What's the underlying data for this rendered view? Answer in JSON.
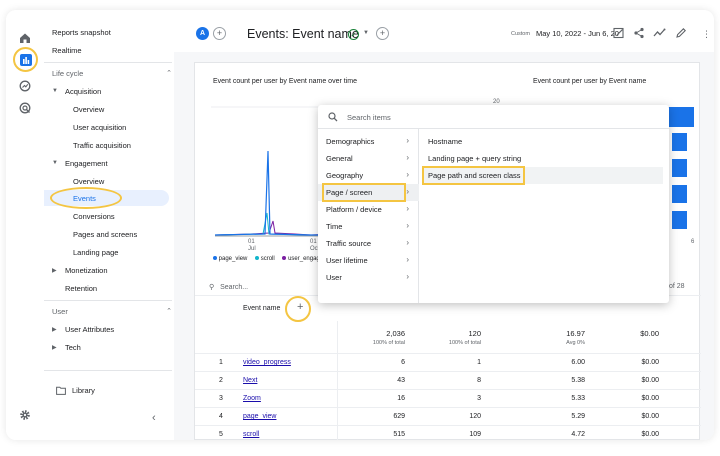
{
  "sidebar": {
    "reports_snapshot": "Reports snapshot",
    "realtime": "Realtime",
    "life_cycle": "Life cycle",
    "acquisition": "Acquisition",
    "acq_overview": "Overview",
    "user_acquisition": "User acquisition",
    "traffic_acquisition": "Traffic acquisition",
    "engagement": "Engagement",
    "eng_overview": "Overview",
    "events": "Events",
    "conversions": "Conversions",
    "pages_and_screens": "Pages and screens",
    "landing_page": "Landing page",
    "monetization": "Monetization",
    "retention": "Retention",
    "user": "User",
    "user_attributes": "User Attributes",
    "tech": "Tech",
    "library": "Library"
  },
  "topbar": {
    "avatar_letter": "A",
    "title": "Events: Event name",
    "date_label": "Custom",
    "date_range": "May 10, 2022 - Jun 6, 20"
  },
  "card": {
    "line_chart_title": "Event count per user by Event name over time",
    "bar_chart_title": "Event count per user by Event name",
    "y_tick_top": "20",
    "x_tick_1_day": "01",
    "x_tick_1_month": "Jul",
    "x_tick_2_day": "01",
    "x_tick_2_month": "Oct",
    "bar_axis_right": "6",
    "legend": [
      "page_view",
      "scroll",
      "user_engag"
    ],
    "search_placeholder": "Search...",
    "pagination": "of 28",
    "event_name_header": "Event name"
  },
  "menu": {
    "search_placeholder": "Search items",
    "categories": [
      "Demographics",
      "General",
      "Geography",
      "Page / screen",
      "Platform / device",
      "Time",
      "Traffic source",
      "User lifetime",
      "User"
    ],
    "options": [
      "Hostname",
      "Landing page + query string",
      "Page path and screen class"
    ]
  },
  "table": {
    "totals": {
      "col1": "2,036",
      "col1_sub": "100% of total",
      "col2": "120",
      "col2_sub": "100% of total",
      "col3": "16.97",
      "col3_sub": "Avg 0%",
      "col4": "$0.00"
    },
    "rows": [
      {
        "idx": "1",
        "name": "video_progress",
        "c1": "6",
        "c2": "1",
        "c3": "6.00",
        "c4": "$0.00"
      },
      {
        "idx": "2",
        "name": "Next",
        "c1": "43",
        "c2": "8",
        "c3": "5.38",
        "c4": "$0.00"
      },
      {
        "idx": "3",
        "name": "Zoom",
        "c1": "16",
        "c2": "3",
        "c3": "5.33",
        "c4": "$0.00"
      },
      {
        "idx": "4",
        "name": "page_view",
        "c1": "629",
        "c2": "120",
        "c3": "5.29",
        "c4": "$0.00"
      },
      {
        "idx": "5",
        "name": "scroll",
        "c1": "515",
        "c2": "109",
        "c3": "4.72",
        "c4": "$0.00"
      }
    ]
  },
  "colors": {
    "accent": "#1a73e8",
    "highlight": "#f4c542",
    "series_page_view": "#1a73e8",
    "series_scroll": "#12b5cb",
    "series_user_engagement": "#7b1fa2"
  }
}
